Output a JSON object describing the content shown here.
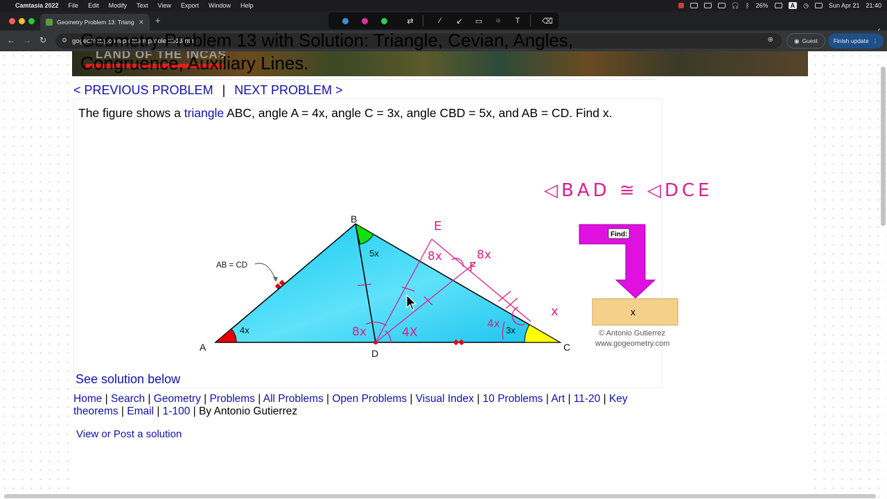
{
  "menubar": {
    "app_name": "Camtasia 2022",
    "menus": [
      "File",
      "Edit",
      "Modify",
      "Text",
      "View",
      "Export",
      "Window",
      "Help"
    ],
    "battery": "26%",
    "input_source": "A",
    "date": "Sun Apr 21",
    "time": "21:40"
  },
  "browser": {
    "tab_title": "Geometry Problem 13: Triang",
    "url": "gogeometry.com/problem/problem013.htm",
    "guest_label": "Guest",
    "update_label": "Finish update",
    "annotation_colors": [
      "#3a8de0",
      "#e0329a",
      "#2fce4a"
    ]
  },
  "page": {
    "banner_text": "LAND OF THE INCAS",
    "title": "Geometry Problem 13 with Solution: Triangle, Cevian, Angles, Congruence, Auxiliary Lines.",
    "prev_label": "< PREVIOUS PROBLEM",
    "nav_sep": "|",
    "next_label": "NEXT PROBLEM >",
    "problem_prefix": "The figure shows a ",
    "problem_link": "triangle",
    "problem_suffix": " ABC, angle A = 4x, angle C = 3x, angle CBD = 5x, and AB = CD. Find x.",
    "see_solution": "See solution below",
    "footer_links": [
      "Home",
      "Search",
      "Geometry",
      "Problems",
      "All Problems",
      "Open Problems",
      "Visual Index",
      "10 Problems",
      "Art",
      "11-20",
      "Key theorems",
      "Email",
      "1-100"
    ],
    "byline": "By Antonio Gutierrez",
    "view_post": "View or Post a solution"
  },
  "figure": {
    "vertex_a": "A",
    "vertex_b": "B",
    "vertex_c": "C",
    "vertex_d": "D",
    "angle_a": "4x",
    "angle_c": "3x",
    "angle_cbd": "5x",
    "note": "AB = CD",
    "find_label": "Find:",
    "answer_label": "x",
    "copyright": "© Antonio Gutierrez",
    "website": "www.gogeometry.com",
    "colors": {
      "triangle": "#20d0f0",
      "angle_a": "#e00000",
      "angle_b": "#00dd00",
      "angle_c": "#ffff00",
      "find_arrow": "#e010e0",
      "answer_box": "#f5d08a",
      "ink": "#d8208a"
    }
  },
  "handwriting": {
    "congruence": "◁BAD ≅ ◁DCE",
    "point_e": "E",
    "point_f": "F",
    "angle_8x_near_e": "8x",
    "angle_8x_near_f": "8x",
    "angle_8x_at_d": "8x",
    "angle_4x_at_d": "4X",
    "angle_4x_at_c": "4x",
    "angle_x_outside": "x"
  }
}
